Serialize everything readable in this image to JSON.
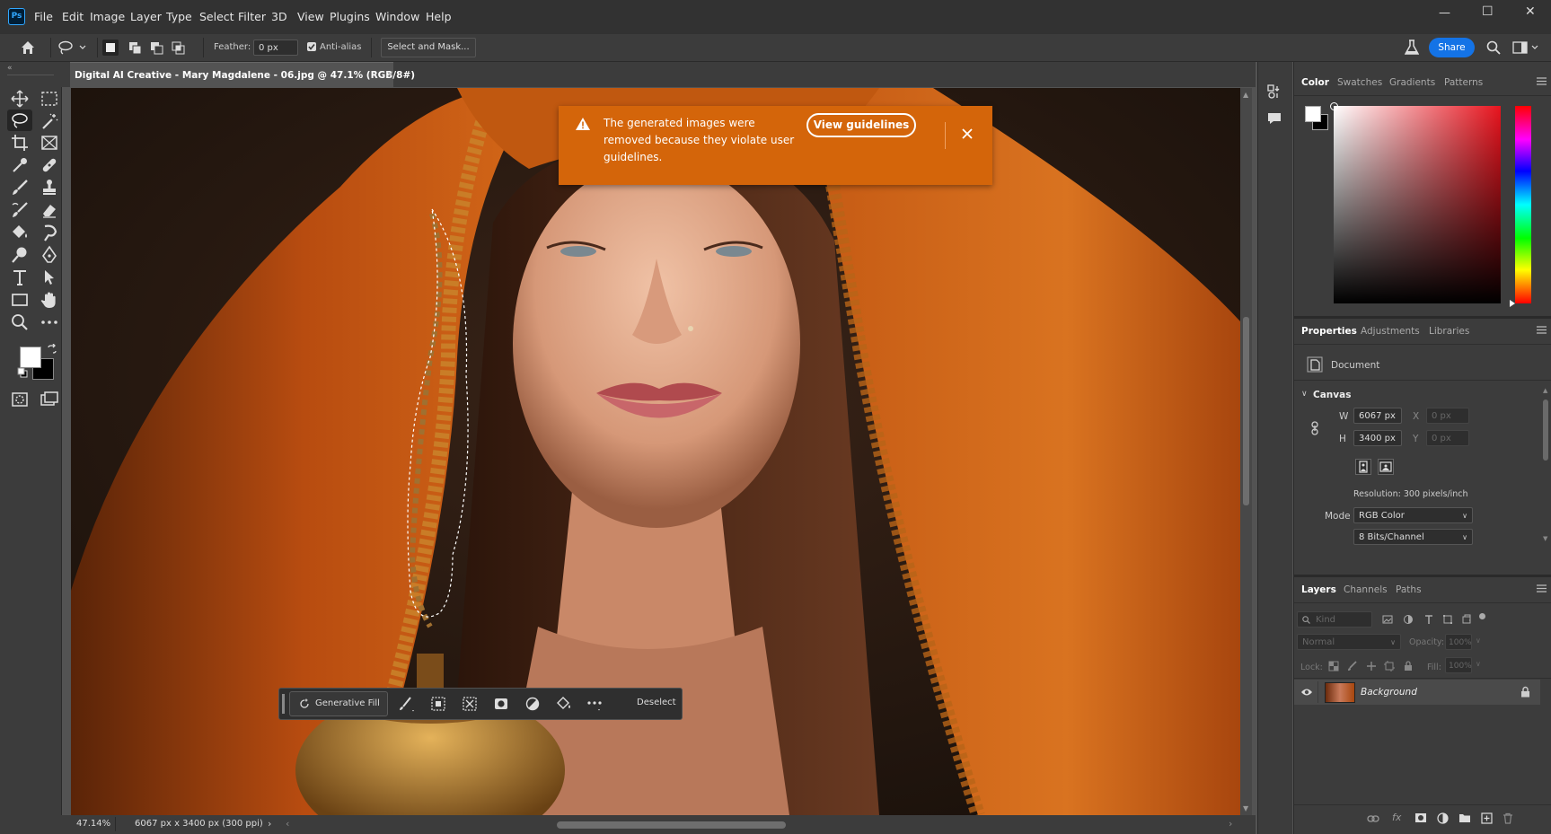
{
  "app": {
    "logo_text": "Ps"
  },
  "menu": [
    "File",
    "Edit",
    "Image",
    "Layer",
    "Type",
    "Select",
    "Filter",
    "3D",
    "View",
    "Plugins",
    "Window",
    "Help"
  ],
  "window_controls": {
    "minimize": "—",
    "maximize": "☐",
    "close": "✕"
  },
  "options_bar": {
    "feather_label": "Feather:",
    "feather_value": "0 px",
    "anti_alias_label": "Anti-alias",
    "select_mask_label": "Select and Mask...",
    "share_label": "Share"
  },
  "document": {
    "tab_title": "Digital AI Creative - Mary Magdalene - 06.jpg @ 47.1% (RGB/8#)",
    "zoom": "47.14%",
    "info": "6067 px x 3400 px (300 ppi)"
  },
  "banner": {
    "message": "The generated images were removed because they violate user guidelines.",
    "line1": "The generated images were",
    "line2": "removed because they violate user",
    "line3": "guidelines.",
    "button": "View guidelines",
    "color": "#d4650a"
  },
  "contextual_bar": {
    "generative_fill": "Generative Fill",
    "deselect": "Deselect"
  },
  "color_panel": {
    "tabs": [
      "Color",
      "Swatches",
      "Gradients",
      "Patterns"
    ],
    "active_tab": "Color"
  },
  "properties_panel": {
    "tabs": [
      "Properties",
      "Adjustments",
      "Libraries"
    ],
    "document_label": "Document",
    "canvas_label": "Canvas",
    "w_label": "W",
    "w_value": "6067 px",
    "h_label": "H",
    "h_value": "3400 px",
    "x_label": "X",
    "x_value": "0 px",
    "y_label": "Y",
    "y_value": "0 px",
    "resolution": "Resolution: 300 pixels/inch",
    "mode_label": "Mode",
    "mode_value": "RGB Color",
    "bits_value": "8 Bits/Channel"
  },
  "layers_panel": {
    "tabs": [
      "Layers",
      "Channels",
      "Paths"
    ],
    "kind_placeholder": "Kind",
    "blend_mode": "Normal",
    "opacity_label": "Opacity:",
    "opacity_value": "100%",
    "lock_label": "Lock:",
    "fill_label": "Fill:",
    "fill_value": "100%",
    "layers": [
      {
        "name": "Background"
      }
    ]
  },
  "colors": {
    "accent": "#1473e6",
    "banner": "#d4650a",
    "ui_dark": "#323232",
    "panel": "#3c3c3c"
  }
}
